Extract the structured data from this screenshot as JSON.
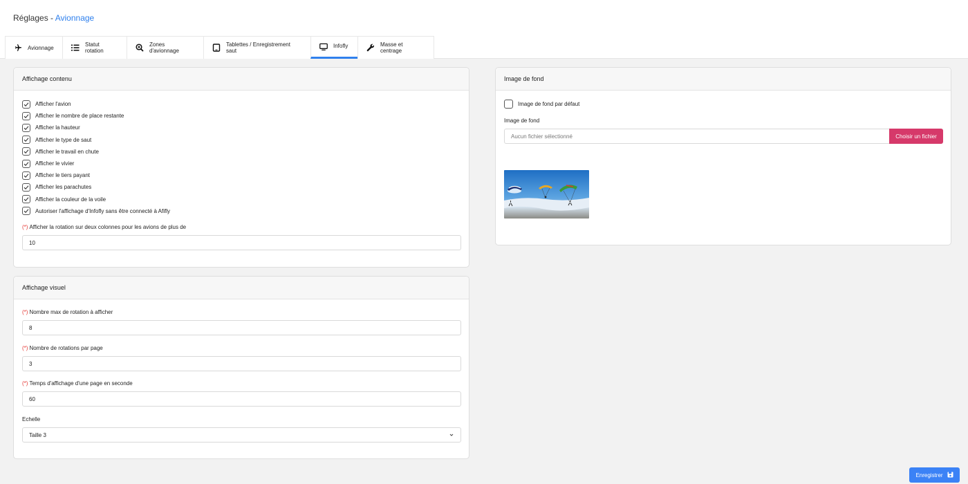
{
  "header": {
    "title": "Réglages",
    "separator": " - ",
    "section": "Avionnage"
  },
  "tabs": [
    {
      "label": "Avionnage",
      "icon": "plane-icon"
    },
    {
      "label": "Statut rotation",
      "icon": "list-icon"
    },
    {
      "label": "Zones d'avionnage",
      "icon": "zoom-icon"
    },
    {
      "label": "Tablettes / Enregistrement saut",
      "icon": "tablet-icon"
    },
    {
      "label": "Infofly",
      "icon": "monitor-icon",
      "active": true
    },
    {
      "label": "Masse et centrage",
      "icon": "wrench-icon"
    }
  ],
  "contenu": {
    "title": "Affichage contenu",
    "checkboxes": [
      {
        "label": "Afficher l'avion",
        "checked": true
      },
      {
        "label": "Afficher le nombre de place restante",
        "checked": true
      },
      {
        "label": "Afficher la hauteur",
        "checked": true
      },
      {
        "label": "Afficher le type de saut",
        "checked": true
      },
      {
        "label": "Afficher le travail en chute",
        "checked": true
      },
      {
        "label": "Afficher le vivier",
        "checked": true
      },
      {
        "label": "Afficher le tiers payant",
        "checked": true
      },
      {
        "label": "Afficher les parachutes",
        "checked": true
      },
      {
        "label": "Afficher la couleur de la voile",
        "checked": true
      },
      {
        "label": "Autoriser l'affichage d'Infofly sans être connecté à Afifly",
        "checked": true
      }
    ],
    "required_marker": "(*)",
    "two_columns_label": "Afficher la rotation sur deux colonnes pour les avions de plus de",
    "two_columns_value": "10"
  },
  "visuel": {
    "title": "Affichage visuel",
    "fields": [
      {
        "label": "Nombre max de rotation à afficher",
        "value": "8",
        "required": true
      },
      {
        "label": "Nombre de rotations par page",
        "value": "3",
        "required": true
      },
      {
        "label": "Temps d'affichage d'une page en seconde",
        "value": "60",
        "required": true
      }
    ],
    "scale_label": "Echelle",
    "scale_value": "Taille 3"
  },
  "fond": {
    "title": "Image de fond",
    "default_label": "Image de fond par défaut",
    "default_checked": false,
    "file_label": "Image de fond",
    "file_placeholder": "Aucun fichier sélectionné",
    "file_button": "Choisir un fichier"
  },
  "save_label": "Enregistrer",
  "colors": {
    "accent": "#2f80ed",
    "file_button": "#d6396a",
    "save_button": "#3b82f6",
    "required": "#e53935"
  }
}
